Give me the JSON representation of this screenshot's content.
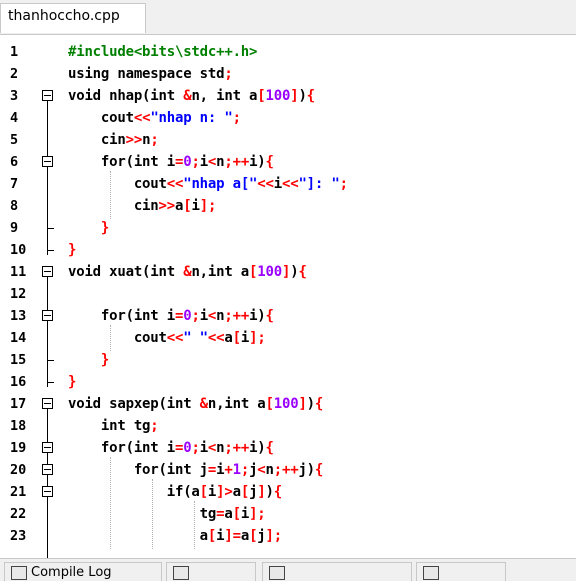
{
  "tab": {
    "filename": "thanhoccho.cpp"
  },
  "bottom_tabs": [
    "Compile Log",
    "",
    "",
    ""
  ],
  "lines": [
    {
      "n": "1",
      "code": [
        [
          "pp",
          "#include<bits\\stdc++.h>"
        ]
      ]
    },
    {
      "n": "2",
      "code": [
        [
          "kw",
          "using namespace std"
        ],
        [
          "op",
          ";"
        ]
      ]
    },
    {
      "n": "3",
      "code": [
        [
          "kw",
          "void nhap(int "
        ],
        [
          "op",
          "&"
        ],
        [
          "kw",
          "n, int a"
        ],
        [
          "brk",
          "["
        ],
        [
          "num",
          "100"
        ],
        [
          "brk",
          "]"
        ],
        [
          "kw",
          ")"
        ],
        [
          "brk",
          "{"
        ]
      ]
    },
    {
      "n": "4",
      "code": [
        [
          "kw",
          "    cout"
        ],
        [
          "op",
          "<<"
        ],
        [
          "str",
          "\"nhap n: \""
        ],
        [
          "op",
          ";"
        ]
      ]
    },
    {
      "n": "5",
      "code": [
        [
          "kw",
          "    cin"
        ],
        [
          "op",
          ">>"
        ],
        [
          "kw",
          "n"
        ],
        [
          "op",
          ";"
        ]
      ]
    },
    {
      "n": "6",
      "code": [
        [
          "kw",
          "    for(int i"
        ],
        [
          "op",
          "="
        ],
        [
          "num",
          "0"
        ],
        [
          "op",
          ";"
        ],
        [
          "kw",
          "i"
        ],
        [
          "op",
          "<"
        ],
        [
          "kw",
          "n"
        ],
        [
          "op",
          ";++"
        ],
        [
          "kw",
          "i)"
        ],
        [
          "brk",
          "{"
        ]
      ]
    },
    {
      "n": "7",
      "code": [
        [
          "kw",
          "        cout"
        ],
        [
          "op",
          "<<"
        ],
        [
          "str",
          "\"nhap a[\""
        ],
        [
          "op",
          "<<"
        ],
        [
          "kw",
          "i"
        ],
        [
          "op",
          "<<"
        ],
        [
          "str",
          "\"]: \""
        ],
        [
          "op",
          ";"
        ]
      ]
    },
    {
      "n": "8",
      "code": [
        [
          "kw",
          "        cin"
        ],
        [
          "op",
          ">>"
        ],
        [
          "kw",
          "a"
        ],
        [
          "brk",
          "["
        ],
        [
          "kw",
          "i"
        ],
        [
          "brk",
          "]"
        ],
        [
          "op",
          ";"
        ]
      ]
    },
    {
      "n": "9",
      "code": [
        [
          "brk",
          "    }"
        ]
      ]
    },
    {
      "n": "10",
      "code": [
        [
          "brk",
          "}"
        ]
      ]
    },
    {
      "n": "11",
      "code": [
        [
          "kw",
          "void xuat(int "
        ],
        [
          "op",
          "&"
        ],
        [
          "kw",
          "n,int a"
        ],
        [
          "brk",
          "["
        ],
        [
          "num",
          "100"
        ],
        [
          "brk",
          "]"
        ],
        [
          "kw",
          ")"
        ],
        [
          "brk",
          "{"
        ]
      ]
    },
    {
      "n": "12",
      "code": []
    },
    {
      "n": "13",
      "code": [
        [
          "kw",
          "    for(int i"
        ],
        [
          "op",
          "="
        ],
        [
          "num",
          "0"
        ],
        [
          "op",
          ";"
        ],
        [
          "kw",
          "i"
        ],
        [
          "op",
          "<"
        ],
        [
          "kw",
          "n"
        ],
        [
          "op",
          ";++"
        ],
        [
          "kw",
          "i)"
        ],
        [
          "brk",
          "{"
        ]
      ]
    },
    {
      "n": "14",
      "code": [
        [
          "kw",
          "        cout"
        ],
        [
          "op",
          "<<"
        ],
        [
          "str",
          "\" \""
        ],
        [
          "op",
          "<<"
        ],
        [
          "kw",
          "a"
        ],
        [
          "brk",
          "["
        ],
        [
          "kw",
          "i"
        ],
        [
          "brk",
          "]"
        ],
        [
          "op",
          ";"
        ]
      ]
    },
    {
      "n": "15",
      "code": [
        [
          "brk",
          "    }"
        ]
      ]
    },
    {
      "n": "16",
      "code": [
        [
          "brk",
          "}"
        ]
      ]
    },
    {
      "n": "17",
      "code": [
        [
          "kw",
          "void sapxep(int "
        ],
        [
          "op",
          "&"
        ],
        [
          "kw",
          "n,int a"
        ],
        [
          "brk",
          "["
        ],
        [
          "num",
          "100"
        ],
        [
          "brk",
          "]"
        ],
        [
          "kw",
          ")"
        ],
        [
          "brk",
          "{"
        ]
      ]
    },
    {
      "n": "18",
      "code": [
        [
          "kw",
          "    int tg"
        ],
        [
          "op",
          ";"
        ]
      ]
    },
    {
      "n": "19",
      "code": [
        [
          "kw",
          "    for(int i"
        ],
        [
          "op",
          "="
        ],
        [
          "num",
          "0"
        ],
        [
          "op",
          ";"
        ],
        [
          "kw",
          "i"
        ],
        [
          "op",
          "<"
        ],
        [
          "kw",
          "n"
        ],
        [
          "op",
          ";++"
        ],
        [
          "kw",
          "i)"
        ],
        [
          "brk",
          "{"
        ]
      ]
    },
    {
      "n": "20",
      "code": [
        [
          "kw",
          "        for(int j"
        ],
        [
          "op",
          "="
        ],
        [
          "kw",
          "i"
        ],
        [
          "op",
          "+"
        ],
        [
          "num",
          "1"
        ],
        [
          "op",
          ";"
        ],
        [
          "kw",
          "j"
        ],
        [
          "op",
          "<"
        ],
        [
          "kw",
          "n"
        ],
        [
          "op",
          ";++"
        ],
        [
          "kw",
          "j)"
        ],
        [
          "brk",
          "{"
        ]
      ]
    },
    {
      "n": "21",
      "code": [
        [
          "kw",
          "            if(a"
        ],
        [
          "brk",
          "["
        ],
        [
          "kw",
          "i"
        ],
        [
          "brk",
          "]"
        ],
        [
          "op",
          ">"
        ],
        [
          "kw",
          "a"
        ],
        [
          "brk",
          "["
        ],
        [
          "kw",
          "j"
        ],
        [
          "brk",
          "]"
        ],
        [
          "kw",
          ")"
        ],
        [
          "brk",
          "{"
        ]
      ]
    },
    {
      "n": "22",
      "code": [
        [
          "kw",
          "                tg"
        ],
        [
          "op",
          "="
        ],
        [
          "kw",
          "a"
        ],
        [
          "brk",
          "["
        ],
        [
          "kw",
          "i"
        ],
        [
          "brk",
          "]"
        ],
        [
          "op",
          ";"
        ]
      ]
    },
    {
      "n": "23",
      "code": [
        [
          "kw",
          "                a"
        ],
        [
          "brk",
          "["
        ],
        [
          "kw",
          "i"
        ],
        [
          "brk",
          "]"
        ],
        [
          "op",
          "="
        ],
        [
          "kw",
          "a"
        ],
        [
          "brk",
          "["
        ],
        [
          "kw",
          "j"
        ],
        [
          "brk",
          "]"
        ],
        [
          "op",
          ";"
        ]
      ]
    }
  ]
}
